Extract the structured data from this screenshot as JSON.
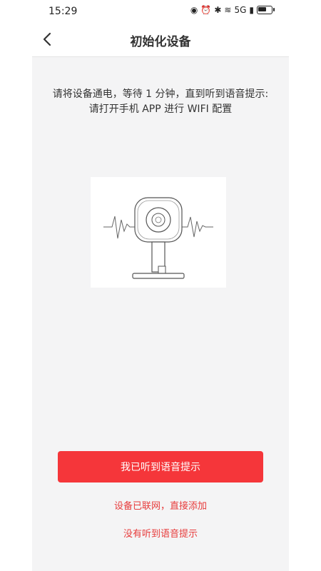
{
  "status": {
    "time": "15:29",
    "icons": [
      "eye-icon",
      "alarm-icon",
      "bluetooth-icon",
      "wifi-icon",
      "signal-icon",
      "battery-icon"
    ],
    "network_label": "5G"
  },
  "header": {
    "title": "初始化设备"
  },
  "instruction": {
    "line1": "请将设备通电，等待 1 分钟，直到听到语音提示:",
    "line2": "请打开手机 APP 进行 WIFI 配置"
  },
  "actions": {
    "primary": "我已听到语音提示",
    "connected": "设备已联网，直接添加",
    "no_voice": "没有听到语音提示"
  },
  "colors": {
    "accent": "#f5363a",
    "link": "#e73b3b",
    "background": "#f4f4f5"
  }
}
